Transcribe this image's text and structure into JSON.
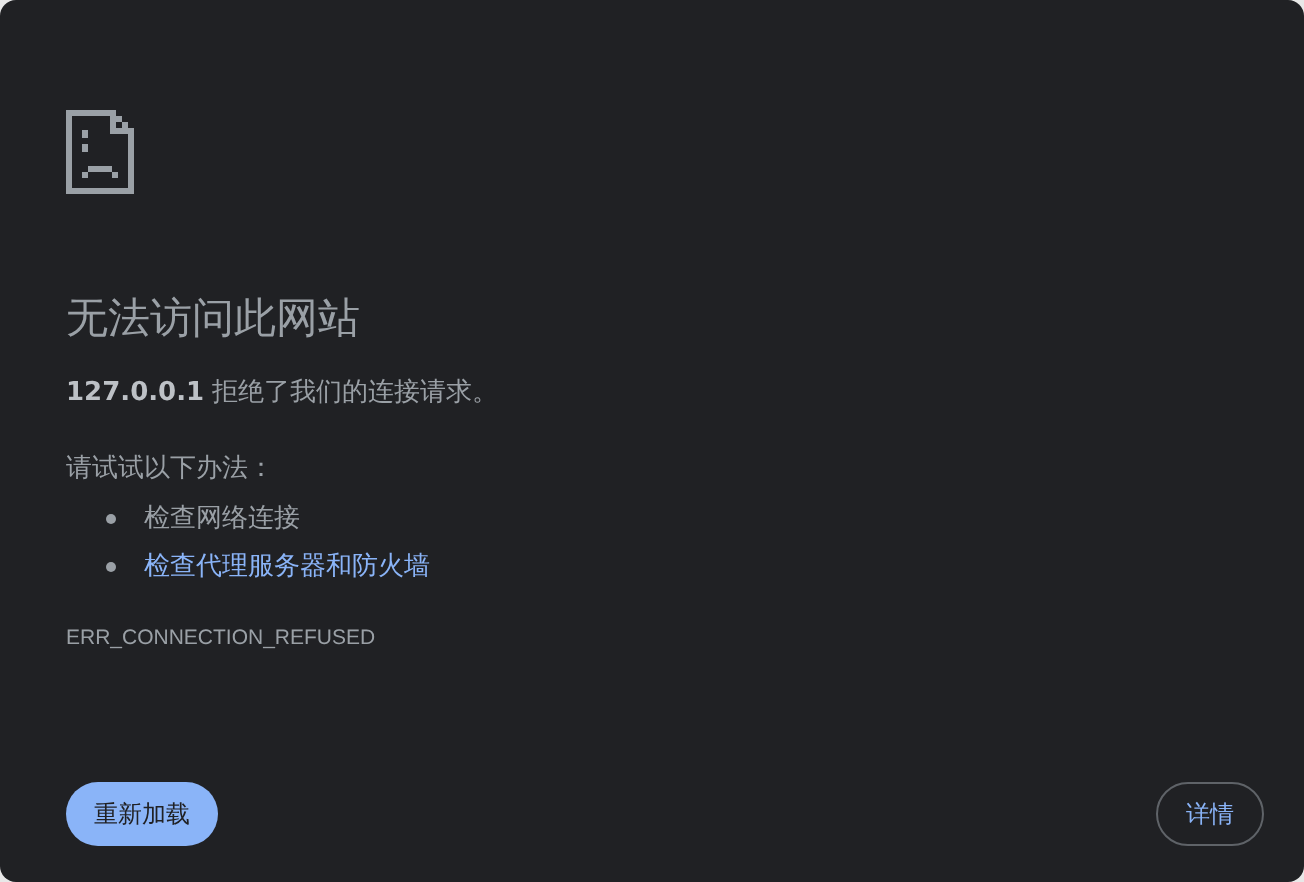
{
  "title": "无法访问此网站",
  "message": "**127.0.0.1** 拒绝了我们的连接请求。",
  "suggestions_heading": "请试试以下办法：",
  "suggestions": [
    {
      "kind": "text",
      "label": "检查网络连接"
    },
    {
      "kind": "link",
      "label": "检查代理服务器和防火墙"
    }
  ],
  "error_code": "ERR_CONNECTION_REFUSED",
  "buttons": [
    {
      "kind": "primary",
      "label": "重新加载"
    },
    {
      "kind": "secondary",
      "label": "详情"
    }
  ]
}
